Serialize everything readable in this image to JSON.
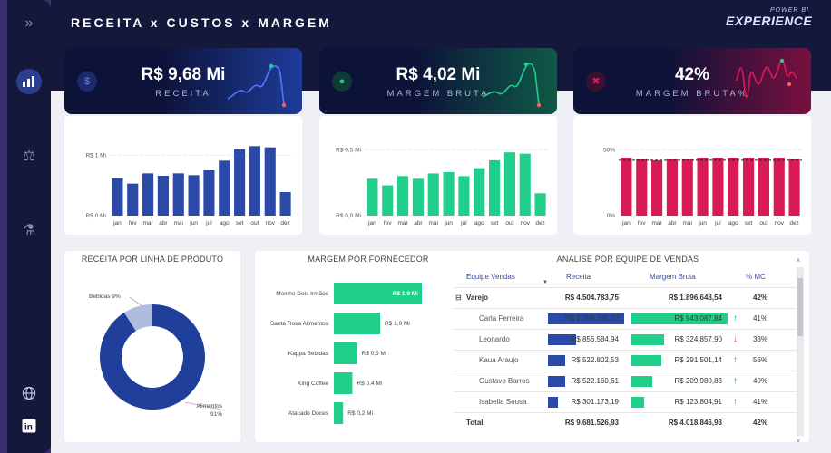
{
  "header": {
    "title": "RECEITA x CUSTOS x MARGEM",
    "logo_line1": "POWER BI",
    "logo_line2": "EXPERIENCE"
  },
  "sidebar": {
    "items": [
      {
        "icon": "chevrons-right-icon"
      },
      {
        "icon": "chart-icon"
      },
      {
        "icon": "scale-icon"
      },
      {
        "icon": "flask-icon"
      },
      {
        "icon": "globe-icon"
      },
      {
        "icon": "linkedin-icon"
      }
    ]
  },
  "kpis": [
    {
      "value": "R$ 9,68 Mi",
      "label": "RECEITA",
      "color": "#2b4aa8"
    },
    {
      "value": "R$ 4,02 Mi",
      "label": "MARGEM BRUTA",
      "color": "#1fcf8a"
    },
    {
      "value": "42%",
      "label": "MARGEM BRUTA%",
      "color": "#d81b55"
    }
  ],
  "chart_data": [
    {
      "type": "bar",
      "categories": [
        "jan",
        "fev",
        "mar",
        "abr",
        "mai",
        "jun",
        "jul",
        "ago",
        "set",
        "out",
        "nov",
        "dez"
      ],
      "values": [
        0.62,
        0.53,
        0.7,
        0.66,
        0.7,
        0.67,
        0.75,
        0.91,
        1.1,
        1.15,
        1.13,
        0.39
      ],
      "ytick_labels": [
        "R$ 0 Mi",
        "R$ 1 Mi"
      ],
      "ylim": [
        0,
        1.2
      ]
    },
    {
      "type": "bar",
      "categories": [
        "jan",
        "fev",
        "mar",
        "abr",
        "mai",
        "jun",
        "jul",
        "ago",
        "set",
        "out",
        "nov",
        "dez"
      ],
      "values": [
        0.28,
        0.23,
        0.3,
        0.28,
        0.32,
        0.33,
        0.3,
        0.36,
        0.42,
        0.48,
        0.47,
        0.17
      ],
      "ytick_labels": [
        "R$ 0,0 Mi",
        "R$ 0,5 Mi"
      ],
      "ylim": [
        0,
        0.55
      ]
    },
    {
      "type": "bar",
      "categories": [
        "jan",
        "fev",
        "mar",
        "abr",
        "mai",
        "jun",
        "jul",
        "ago",
        "set",
        "out",
        "nov",
        "dez"
      ],
      "values": [
        44,
        43,
        42,
        43,
        43,
        44,
        44,
        44,
        44,
        44,
        44,
        43
      ],
      "ytick_labels": [
        "0%",
        "50%"
      ],
      "reference_line": 42,
      "ylim": [
        0,
        55
      ]
    },
    {
      "type": "pie",
      "title": "RECEITA POR LINHA DE PRODUTO",
      "slices": [
        {
          "name": "Alimentos",
          "value": 91,
          "label": "91%"
        },
        {
          "name": "Bebidas",
          "value": 9,
          "label": "9%"
        }
      ]
    },
    {
      "type": "bar",
      "title": "MARGEM POR FORNECEDOR",
      "categories": [
        "Moinho Dois Irmãos",
        "Santa Rosa Alimentos",
        "Kappa Bebidas",
        "King Coffee",
        "Atacado Doces"
      ],
      "values": [
        1.9,
        1.0,
        0.5,
        0.4,
        0.2
      ],
      "data_labels": [
        "R$ 1,9 Mi",
        "R$ 1,0 Mi",
        "R$ 0,5 Mi",
        "R$ 0,4 Mi",
        "R$ 0,2 Mi"
      ]
    }
  ],
  "table": {
    "title": "ANALISE POR EQUIPE DE VENDAS",
    "headers": [
      "Equipe Vendas",
      "Receita",
      "Margem Bruta",
      "% MC"
    ],
    "group": {
      "expander": "⊟",
      "name": "Varejo",
      "receita": "R$ 4.504.783,75",
      "margem": "R$ 1.896.648,54",
      "mc": "42%"
    },
    "rows": [
      {
        "name": "Carla Ferreira",
        "receita": "R$ 2.296.245,72",
        "margem": "R$ 943.087,84",
        "mc": "41%",
        "trend": "up",
        "r": 1.0,
        "m": 1.0
      },
      {
        "name": "Leonardo",
        "receita": "R$ 856.584,94",
        "margem": "R$ 324.857,90",
        "mc": "38%",
        "trend": "down",
        "r": 0.37,
        "m": 0.34
      },
      {
        "name": "Kaua Araujo",
        "receita": "R$ 522.802,53",
        "margem": "R$ 291.501,14",
        "mc": "56%",
        "trend": "up",
        "r": 0.23,
        "m": 0.31
      },
      {
        "name": "Gustavo Barros",
        "receita": "R$ 522.160,61",
        "margem": "R$ 209.980,83",
        "mc": "40%",
        "trend": "up",
        "r": 0.23,
        "m": 0.22
      },
      {
        "name": "Isabella Sousa",
        "receita": "R$ 301.173,19",
        "margem": "R$ 123.804,91",
        "mc": "41%",
        "trend": "up",
        "r": 0.13,
        "m": 0.13
      }
    ],
    "total": {
      "name": "Total",
      "receita": "R$ 9.681.526,93",
      "margem": "R$ 4.018.846,93",
      "mc": "42%"
    }
  }
}
